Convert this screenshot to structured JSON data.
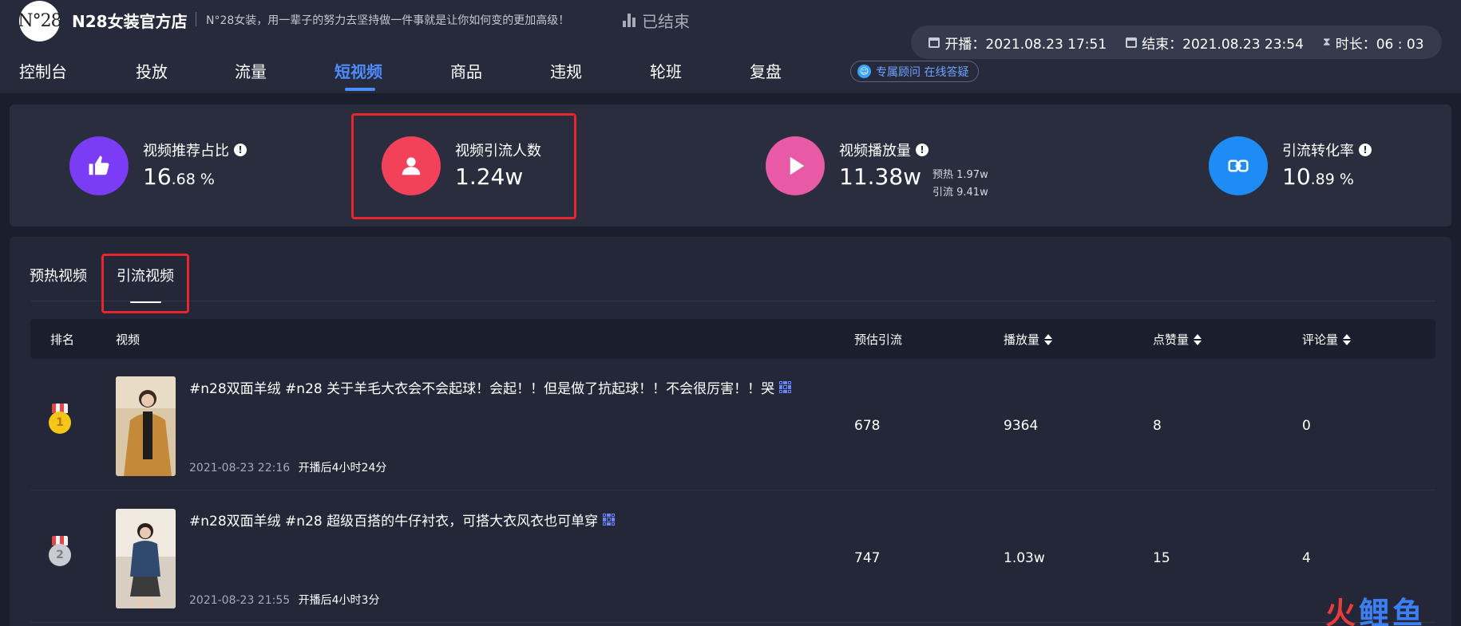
{
  "header": {
    "logo_text": "N°28",
    "shop_name": "N28女装官方店",
    "slogan": "N°28女装，用一辈子的努力去坚持做一件事就是让你如何变的更加高级！",
    "status": "已结束",
    "start_label": "开播：2021.08.23 17:51",
    "end_label": "结束：2021.08.23 23:54",
    "duration_label": "时长：06 : 03",
    "consult_label": "专属顾问 在线答疑"
  },
  "nav": {
    "items": [
      "控制台",
      "投放",
      "流量",
      "短视频",
      "商品",
      "违规",
      "轮班",
      "复盘"
    ],
    "active": "短视频"
  },
  "stats": [
    {
      "label": "视频推荐占比",
      "value_int": "16",
      "value_frac": ".68 %",
      "color": "#7a3cf4",
      "icon": "thumbs-up-icon"
    },
    {
      "label": "视频引流人数",
      "value_int": "1.24w",
      "value_frac": "",
      "color": "#f2425a",
      "icon": "person-icon"
    },
    {
      "label": "视频播放量",
      "value_int": "11.38w",
      "value_frac": "",
      "color": "#e85aa6",
      "icon": "play-icon",
      "sub1": "预热  1.97w",
      "sub2": "引流  9.41w"
    },
    {
      "label": "引流转化率",
      "value_int": "10",
      "value_frac": ".89 %",
      "color": "#1e8cf5",
      "icon": "convert-icon"
    }
  ],
  "tabs": [
    "预热视频",
    "引流视频"
  ],
  "active_tab": "引流视频",
  "table": {
    "headers": [
      "排名",
      "视频",
      "预估引流",
      "播放量",
      "点赞量",
      "评论量"
    ],
    "sortable": [
      "播放量",
      "点赞量",
      "评论量"
    ],
    "rows": [
      {
        "rank": "1",
        "rank_color": "#f5c518",
        "title": "#n28双面羊绒 #n28 关于羊毛大衣会不会起球！会起！！但是做了抗起球！！不会很厉害！！哭",
        "date": "2021-08-23 22:16",
        "elapsed": "开播后4小时24分",
        "traffic": "678",
        "plays": "9364",
        "likes": "8",
        "comments": "0"
      },
      {
        "rank": "2",
        "rank_color": "#c9ccd3",
        "title": "#n28双面羊绒 #n28 超级百搭的牛仔衬衣，可搭大衣风衣也可单穿",
        "date": "2021-08-23 21:55",
        "elapsed": "开播后4小时3分",
        "traffic": "747",
        "plays": "1.03w",
        "likes": "15",
        "comments": "4"
      }
    ]
  },
  "watermark": {
    "part1": "火",
    "part2": "鲤鱼"
  }
}
